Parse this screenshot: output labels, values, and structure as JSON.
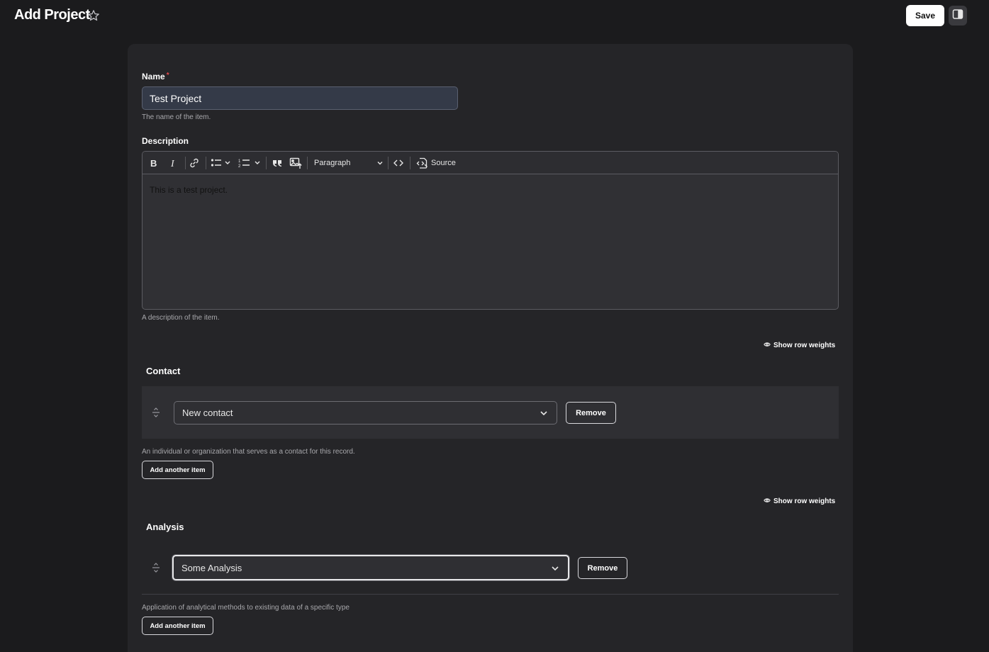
{
  "header": {
    "title": "Add Project",
    "save_label": "Save"
  },
  "form": {
    "name": {
      "label": "Name",
      "required_mark": "*",
      "value": "Test Project",
      "help": "The name of the item."
    },
    "description": {
      "label": "Description",
      "toolbar": {
        "paragraph_label": "Paragraph",
        "source_label": "Source"
      },
      "content": "This is a test project.",
      "help": "A description of the item."
    },
    "contact": {
      "show_weights_label": "Show row weights",
      "title": "Contact",
      "selected": "New contact",
      "remove_label": "Remove",
      "help": "An individual or organization that serves as a contact for this record.",
      "add_label": "Add another item"
    },
    "analysis": {
      "show_weights_label": "Show row weights",
      "title": "Analysis",
      "selected": "Some Analysis",
      "remove_label": "Remove",
      "help": "Application of analytical methods to existing data of a specific type",
      "add_label": "Add another item"
    }
  },
  "colors": {
    "background": "#1b1b1d",
    "card": "#252528",
    "required": "#e5484d",
    "input_fill": "#343a48"
  }
}
